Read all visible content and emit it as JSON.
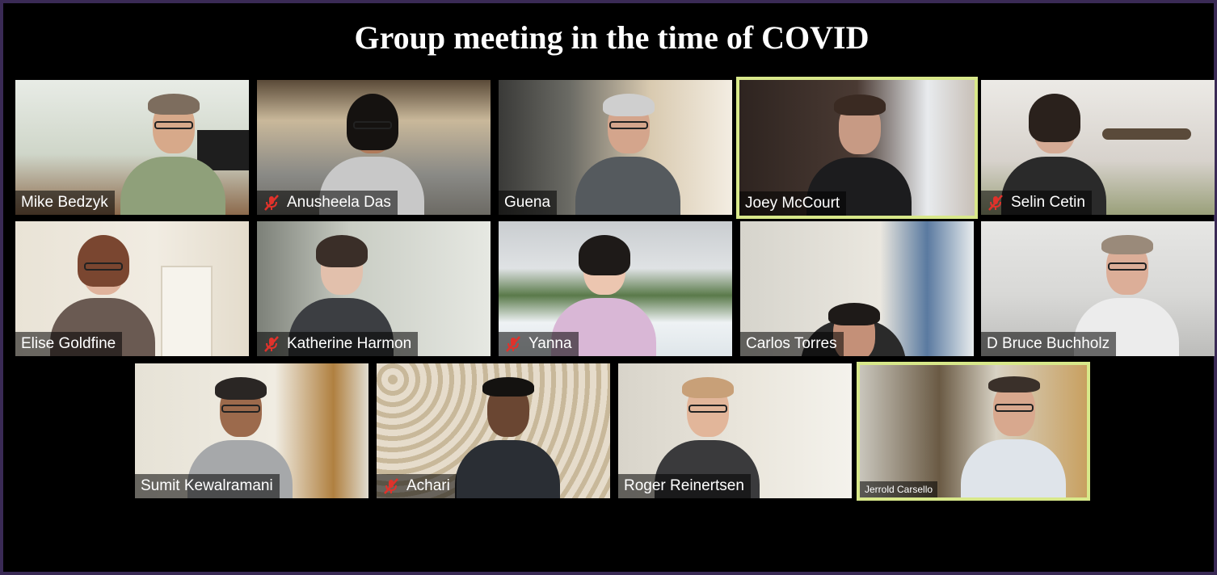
{
  "meeting": {
    "title": "Group meeting in the time of COVID"
  },
  "colors": {
    "active_border": "#d8e88a",
    "muted_icon": "#e0322b",
    "background": "#000000"
  },
  "participants": [
    {
      "name": "Mike Bedzyk",
      "muted": false,
      "active": false
    },
    {
      "name": "Anusheela Das",
      "muted": true,
      "active": false
    },
    {
      "name": "Guena",
      "muted": false,
      "active": false
    },
    {
      "name": "Joey McCourt",
      "muted": false,
      "active": true
    },
    {
      "name": "Selin Cetin",
      "muted": true,
      "active": false
    },
    {
      "name": "Elise Goldfine",
      "muted": false,
      "active": false
    },
    {
      "name": "Katherine Harmon",
      "muted": true,
      "active": false
    },
    {
      "name": "Yanna",
      "muted": true,
      "active": false
    },
    {
      "name": "Carlos Torres",
      "muted": false,
      "active": false
    },
    {
      "name": "D Bruce Buchholz",
      "muted": false,
      "active": false
    },
    {
      "name": "Sumit Kewalramani",
      "muted": false,
      "active": false
    },
    {
      "name": "Achari",
      "muted": true,
      "active": false
    },
    {
      "name": "Roger Reinertsen",
      "muted": false,
      "active": false
    },
    {
      "name": "Jerrold Carsello",
      "muted": false,
      "active": true
    }
  ]
}
